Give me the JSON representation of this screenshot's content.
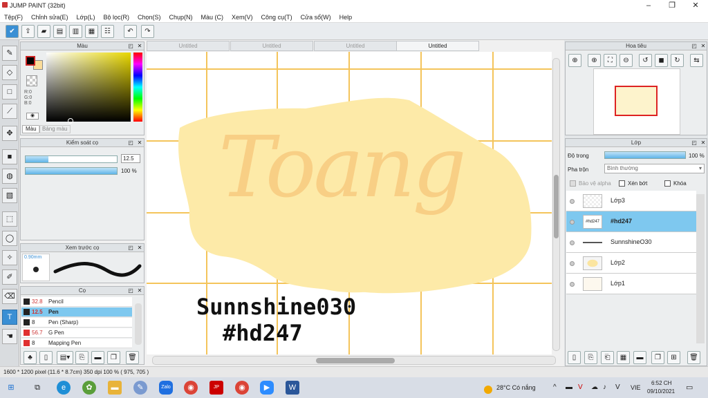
{
  "app": {
    "title": "JUMP PAINT (32bit)"
  },
  "menu": [
    "Tệp(F)",
    "Chỉnh sửa(E)",
    "Lớp(L)",
    "Bộ lọc(R)",
    "Chọn(S)",
    "Chụp(N)",
    "Màu (C)",
    "Xem(V)",
    "Công cụ(T)",
    "Cửa sổ(W)",
    "Help"
  ],
  "tabs": [
    "Untitled",
    "Untitled",
    "Untitled",
    "Untitled"
  ],
  "color_panel": {
    "title": "Màu",
    "rgb": [
      "R:0",
      "G:0",
      "B:0"
    ],
    "tabs": [
      "Màu",
      "Bảng màu"
    ]
  },
  "brush_control": {
    "title": "Kiểm soát cọ",
    "size_value": "12.5",
    "opacity_value": "100 %",
    "size_fraction": 0.25,
    "opacity_fraction": 1.0
  },
  "brush_preview": {
    "title": "Xem trước cọ",
    "size": "0.90mm"
  },
  "brushes": {
    "title": "Cọ",
    "items": [
      {
        "size": "32.8",
        "name": "Pencil",
        "color": "#222222"
      },
      {
        "size": "12.5",
        "name": "Pen",
        "color": "#222222"
      },
      {
        "size": "8",
        "name": "Pen (Sharp)",
        "color": "#222222"
      },
      {
        "size": "56.7",
        "name": "G Pen",
        "color": "#e03030"
      },
      {
        "size": "8",
        "name": "Mapping Pen",
        "color": "#e03030"
      }
    ]
  },
  "canvas": {
    "main_text": "Toang",
    "signature1": "Sunnshine030",
    "signature2": "#hd247"
  },
  "navigator": {
    "title": "Hoa tiêu"
  },
  "layer_panel": {
    "title": "Lớp",
    "opacity_label": "Độ trong",
    "opacity_value": "100 %",
    "opacity_fraction": 1.0,
    "blend_label": "Pha trộn",
    "blend_value": "Bình thường",
    "protect_alpha": "Bảo vệ alpha",
    "clip": "Xén bớt",
    "lock": "Khóa",
    "layers": [
      "Lớp3",
      "#hd247",
      "SunnshineO30",
      "Lớp2",
      "Lớp1"
    ],
    "selected": 1
  },
  "status": {
    "text": "1600 * 1200 pixel   (11.6 * 8.7cm)  350 dpi  100 %  ( 975, 705 )"
  },
  "taskbar": {
    "weather": "28°C  Có nắng",
    "lang": "VIE",
    "time": "6:52 CH",
    "date": "09/10/2021"
  },
  "colors": {
    "accent": "#3a8fd4",
    "grid": "#f4c45a",
    "splash": "#fdeaa8",
    "text": "#f8cf85"
  }
}
